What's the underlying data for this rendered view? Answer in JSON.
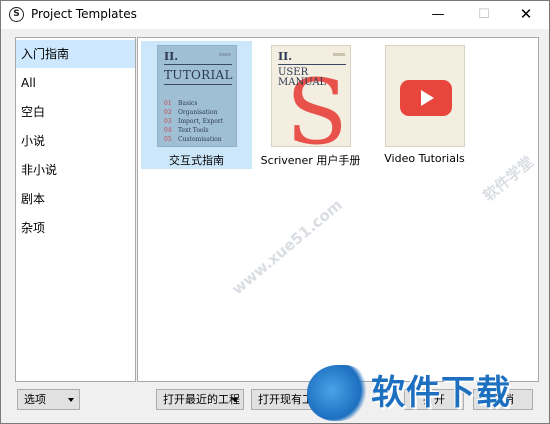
{
  "window": {
    "title": "Project Templates",
    "minimize_glyph": "—",
    "maximize_glyph": "☐",
    "close_glyph": "✕"
  },
  "sidebar": {
    "items": [
      {
        "label": "入门指南",
        "selected": true
      },
      {
        "label": "All",
        "selected": false
      },
      {
        "label": "空白",
        "selected": false
      },
      {
        "label": "小说",
        "selected": false
      },
      {
        "label": "非小说",
        "selected": false
      },
      {
        "label": "剧本",
        "selected": false
      },
      {
        "label": "杂项",
        "selected": false
      }
    ]
  },
  "templates": [
    {
      "label": "交互式指南",
      "selected": true,
      "cover": {
        "numeral": "II.",
        "title": "TUTORIAL",
        "toc": [
          {
            "num": "01",
            "text": "Basics"
          },
          {
            "num": "02",
            "text": "Organisation"
          },
          {
            "num": "03",
            "text": "Import, Export"
          },
          {
            "num": "04",
            "text": "Text Tools"
          },
          {
            "num": "05",
            "text": "Customisation"
          }
        ]
      }
    },
    {
      "label": "Scrivener 用户手册",
      "selected": false,
      "cover": {
        "numeral": "II.",
        "title_line1": "USER",
        "title_line2": "MANUAL",
        "letter": "S"
      }
    },
    {
      "label": "Video Tutorials",
      "selected": false,
      "cover": {
        "icon": "youtube-play-icon"
      }
    }
  ],
  "footer": {
    "options_label": "选项",
    "open_recent_label": "打开最近的工程",
    "open_existing_label": "打开现有工程",
    "open_label": "打开",
    "cancel_label": "取消"
  },
  "watermark": {
    "text": "软件下载",
    "faint_text": "软件学堂",
    "faint_url": "www.xue51.com"
  },
  "colors": {
    "selection": "#cde8ff",
    "tutorial_cover": "#9fbfd5",
    "manual_cover": "#f3eedf",
    "accent_red": "#e8524a",
    "watermark_blue": "#1d6fbf"
  }
}
